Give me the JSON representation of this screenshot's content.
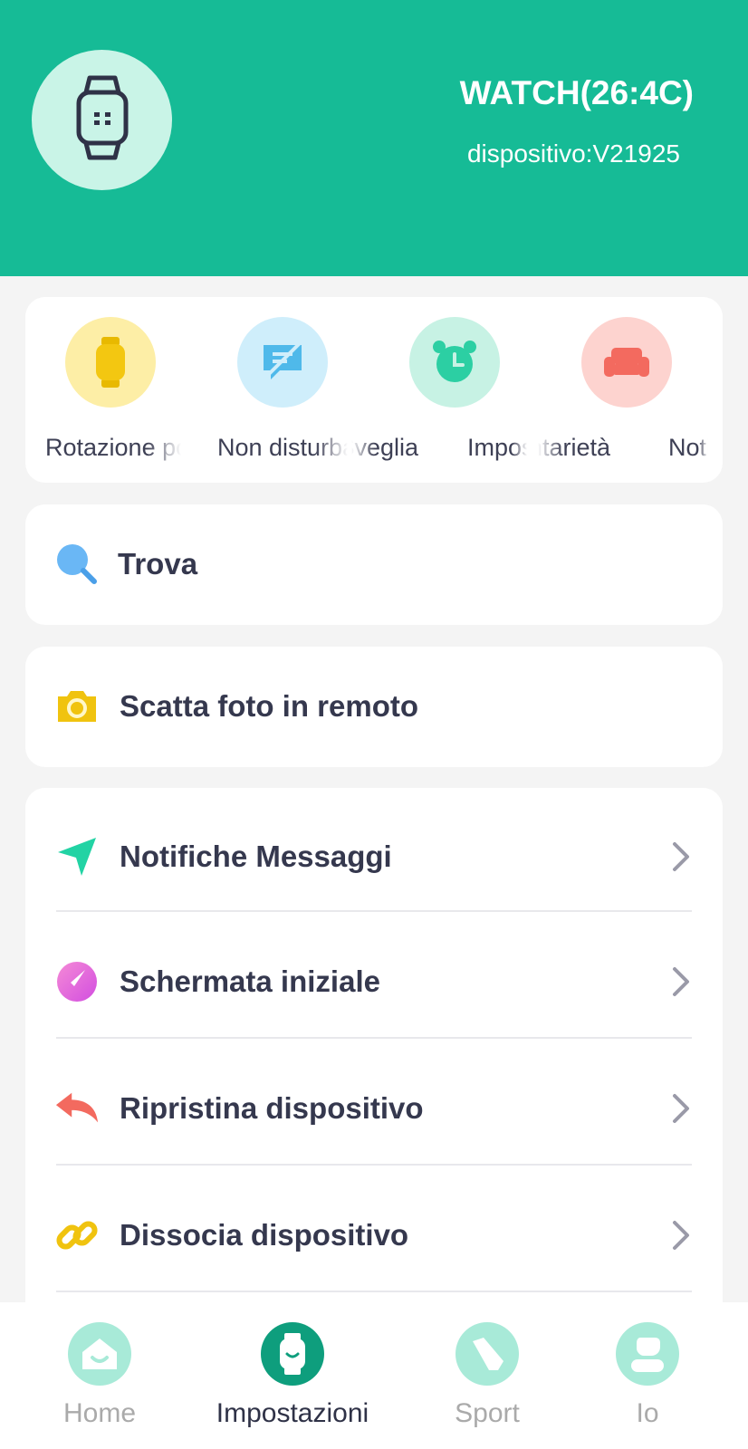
{
  "header": {
    "device_name": "WATCH(26:4C)",
    "device_id": "dispositivo:V21925",
    "avatar_icon": "smartwatch-icon"
  },
  "quick_actions": [
    {
      "label": "Rotazione polso",
      "icon": "watch-rotate-icon",
      "bg": "#fdeea6",
      "fg": "#f0c30f"
    },
    {
      "label": "Non disturbare",
      "icon": "no-message-icon",
      "bg": "#cfeefb",
      "fg": "#4fb9ea"
    },
    {
      "label": "Sveglia",
      "icon": "alarm-clock-icon",
      "bg": "#c7f2e4",
      "fg": "#2ccfa3"
    },
    {
      "label": "Impostazioni",
      "icon": "",
      "bg": "",
      "fg": ""
    },
    {
      "label": "Sedentarietà",
      "icon": "sofa-icon",
      "bg": "#fdd3cf",
      "fg": "#f36a5f"
    },
    {
      "label": "Notifiche",
      "icon": "",
      "bg": "",
      "fg": ""
    }
  ],
  "find": {
    "label": "Trova",
    "icon": "magnifier-icon"
  },
  "remote_camera": {
    "label": "Scatta foto in remoto",
    "icon": "camera-icon"
  },
  "settings_list": [
    {
      "label": "Notifiche Messaggi",
      "icon": "send-arrow-icon"
    },
    {
      "label": "Schermata iniziale",
      "icon": "watchface-icon"
    },
    {
      "label": "Ripristina dispositivo",
      "icon": "reset-arrow-icon"
    },
    {
      "label": "Dissocia dispositivo",
      "icon": "unlink-icon"
    }
  ],
  "tabs": [
    {
      "label": "Home",
      "icon": "home-icon",
      "active": false
    },
    {
      "label": "Impostazioni",
      "icon": "watch-tab-icon",
      "active": true
    },
    {
      "label": "Sport",
      "icon": "shoe-icon",
      "active": false
    },
    {
      "label": "Io",
      "icon": "person-icon",
      "active": false
    }
  ],
  "colors": {
    "brand": "#16bb96",
    "brand_dark": "#0e9e7d",
    "tab_icon_bg": "#a8ead8",
    "text_dark": "#2f3247",
    "chevron": "#9a9aa8"
  }
}
